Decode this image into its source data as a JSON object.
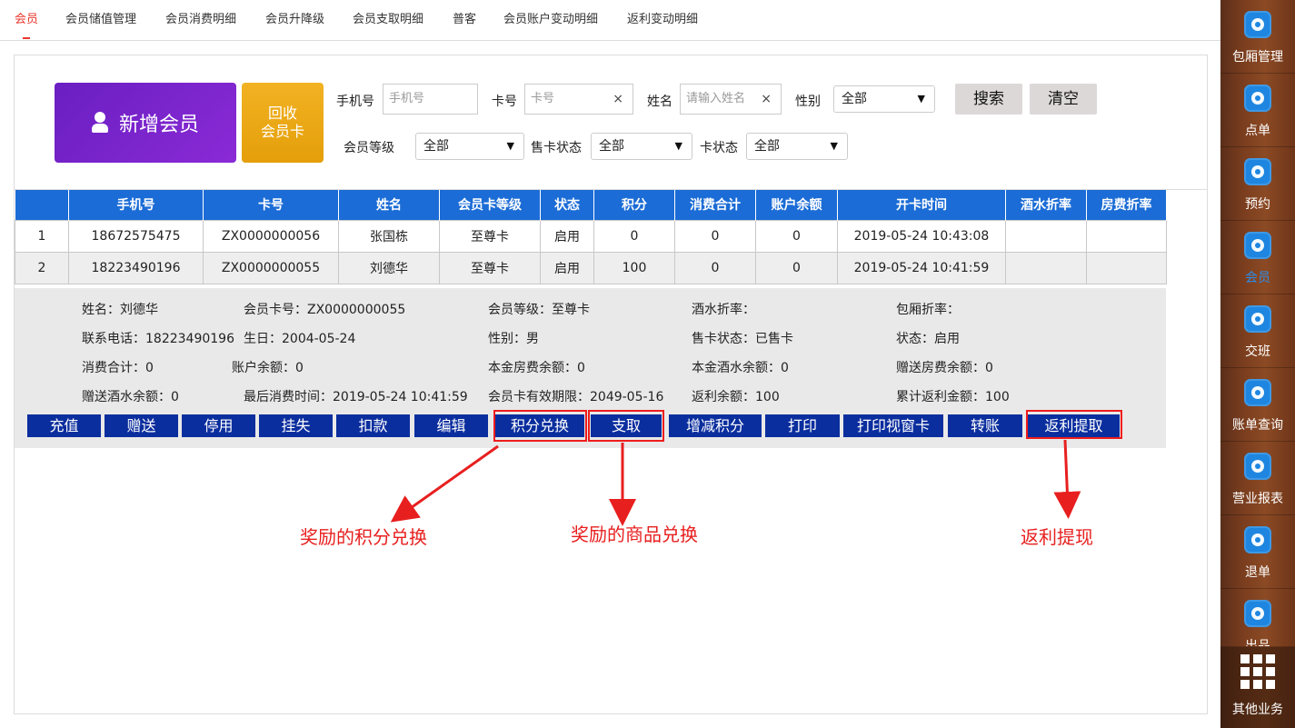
{
  "tabs": [
    "会员",
    "会员储值管理",
    "会员消费明细",
    "会员升降级",
    "会员支取明细",
    "普客",
    "会员账户变动明细",
    "返利变动明细"
  ],
  "active_tab": "会员",
  "actions": {
    "new_member": "新增会员",
    "recycle_line1": "回收",
    "recycle_line2": "会员卡"
  },
  "search": {
    "phone_label": "手机号",
    "phone_placeholder": "手机号",
    "card_label": "卡号",
    "card_placeholder": "卡号",
    "name_label": "姓名",
    "name_placeholder": "请输入姓名",
    "clear_icon": "×",
    "gender_label": "性别",
    "gender_value": "全部",
    "level_label": "会员等级",
    "level_value": "全部",
    "sale_label": "售卡状态",
    "sale_value": "全部",
    "cardstatus_label": "卡状态",
    "cardstatus_value": "全部",
    "search_btn": "搜索",
    "clear_btn": "清空"
  },
  "table": {
    "headers": [
      "",
      "手机号",
      "卡号",
      "姓名",
      "会员卡等级",
      "状态",
      "积分",
      "消费合计",
      "账户余额",
      "开卡时间",
      "酒水折率",
      "房费折率"
    ],
    "rows": [
      [
        "1",
        "18672575475",
        "ZX0000000056",
        "张国栋",
        "至尊卡",
        "启用",
        "0",
        "0",
        "0",
        "2019-05-24 10:43:08",
        "",
        ""
      ],
      [
        "2",
        "18223490196",
        "ZX0000000055",
        "刘德华",
        "至尊卡",
        "启用",
        "100",
        "0",
        "0",
        "2019-05-24 10:41:59",
        "",
        ""
      ]
    ]
  },
  "detail": {
    "name": "姓名：刘德华",
    "card_no": "会员卡号：ZX0000000055",
    "level": "会员等级：至尊卡",
    "drink_rate": "酒水折率：",
    "room_rate": "包厢折率：",
    "phone": "联系电话：18223490196",
    "birthday": "生日：2004-05-24",
    "gender": "性别：男",
    "sale_status": "售卡状态：已售卡",
    "status": "状态：启用",
    "consume_total": "消费合计：0",
    "balance": "账户余额：0",
    "principal_room": "本金房费余额：0",
    "principal_drink": "本金酒水余额：0",
    "gift_room": "赠送房费余额：0",
    "gift_drink": "赠送酒水余额：0",
    "last_consume": "最后消费时间：2019-05-24 10:41:59",
    "expire": "会员卡有效期限：2049-05-16",
    "rebate_balance": "返利余额：100",
    "rebate_total": "累计返利金额：100"
  },
  "action_buttons": [
    "充值",
    "赠送",
    "停用",
    "挂失",
    "扣款",
    "编辑",
    "积分兑换",
    "支取",
    "增减积分",
    "打印",
    "打印视窗卡",
    "转账",
    "返利提取"
  ],
  "annotations": {
    "points": "奖励的积分兑换",
    "goods": "奖励的商品兑换",
    "rebate": "返利提现"
  },
  "annotation_color": "#e81f1f",
  "sidebar": {
    "items": [
      {
        "label": "包厢管理",
        "icon": "room-icon"
      },
      {
        "label": "点单",
        "icon": "order-icon"
      },
      {
        "label": "预约",
        "icon": "reservation-icon"
      },
      {
        "label": "会员",
        "icon": "member-icon"
      },
      {
        "label": "交班",
        "icon": "shift-icon"
      },
      {
        "label": "账单查询",
        "icon": "bill-icon"
      },
      {
        "label": "营业报表",
        "icon": "report-icon"
      },
      {
        "label": "退单",
        "icon": "refund-icon"
      },
      {
        "label": "出品",
        "icon": "output-icon"
      }
    ],
    "other": "其他业务",
    "active": "会员"
  }
}
